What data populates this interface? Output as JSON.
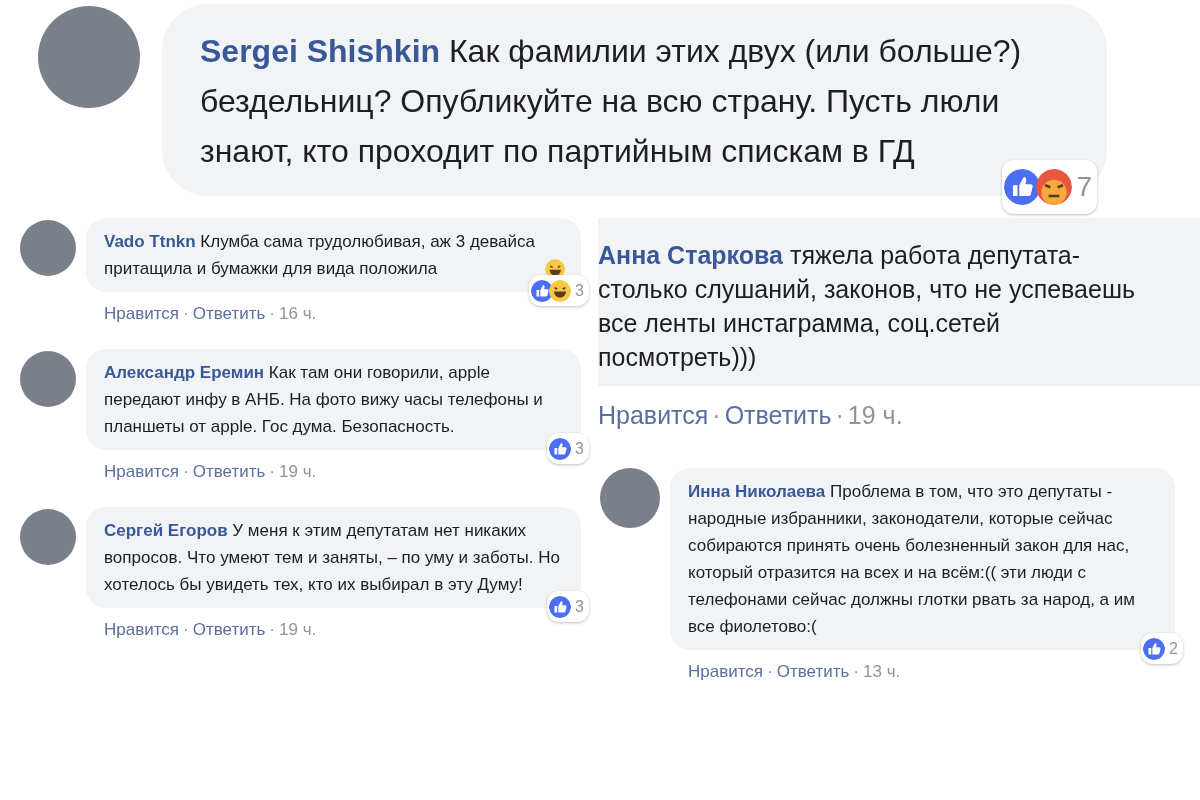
{
  "top_comment": {
    "author": "Sergei Shishkin",
    "text": "Как фамилии этих двух (или больше?) бездельниц? Опубликуйте на всю страну. Пусть люли знают, кто проходит по партийным спискам в ГД",
    "avatar": true,
    "reactions": [
      {
        "kind": "like"
      },
      {
        "kind": "angry"
      }
    ],
    "reaction_count": "7"
  },
  "left_comments": [
    {
      "author": "Vado Ttnkn",
      "text": "Клумба сама трудолюбивая, аж 3 девайса притащила и бумажки для вида положила",
      "avatar": true,
      "emoji": {
        "kind": "laugh"
      },
      "reactions": [
        {
          "kind": "like"
        },
        {
          "kind": "haha"
        }
      ],
      "reaction_count": "3",
      "like_label": "Нравится",
      "separator_1": "·",
      "reply_label": "Ответить",
      "separator_2": "·",
      "time": "16 ч."
    },
    {
      "author": "Александр Еремин",
      "text": "Как там они говорили, apple передают инфу в АНБ. На фото вижу часы телефоны и планшеты от apple. Гос дума. Безопасность.",
      "avatar": true,
      "reactions": [
        {
          "kind": "like"
        }
      ],
      "reaction_count": "3",
      "like_label": "Нравится",
      "separator_1": "·",
      "reply_label": "Ответить",
      "separator_2": "·",
      "time": "19 ч."
    },
    {
      "author": "Сергей Егоров",
      "text": "У меня к этим депутатам нет никаких вопросов. Что умеют тем и заняты, – по уму и заботы. Но хотелось бы увидеть тех, кто их выбирал в эту Думу!",
      "avatar": true,
      "reactions": [
        {
          "kind": "like"
        }
      ],
      "reaction_count": "3",
      "like_label": "Нравится",
      "separator_1": "·",
      "reply_label": "Ответить",
      "separator_2": "·",
      "time": "19 ч."
    }
  ],
  "right_comments": [
    {
      "author": "Анна Старкова",
      "text": "тяжела работа депутата- столько слушаний, законов, что не успеваешь все ленты инстаграмма, соц.сетей посмотреть)))",
      "avatar": false,
      "like_label": "Нравится",
      "separator_1": "·",
      "reply_label": "Ответить",
      "separator_2": "·",
      "time": "19 ч."
    },
    {
      "author": "Инна Николаева",
      "text": "Проблема в том, что это депутаты - народные избранники, законодатели, которые сейчас собираются принять очень болезненный закон для нас, который отразится на всех и на всём:(( эти люди с телефонами сейчас должны глотки рвать за народ, а им все фиолетово:(",
      "avatar": true,
      "reactions": [
        {
          "kind": "like"
        }
      ],
      "reaction_count": "2",
      "like_label": "Нравится",
      "separator_1": "·",
      "reply_label": "Ответить",
      "separator_2": "·",
      "time": "13 ч."
    }
  ]
}
